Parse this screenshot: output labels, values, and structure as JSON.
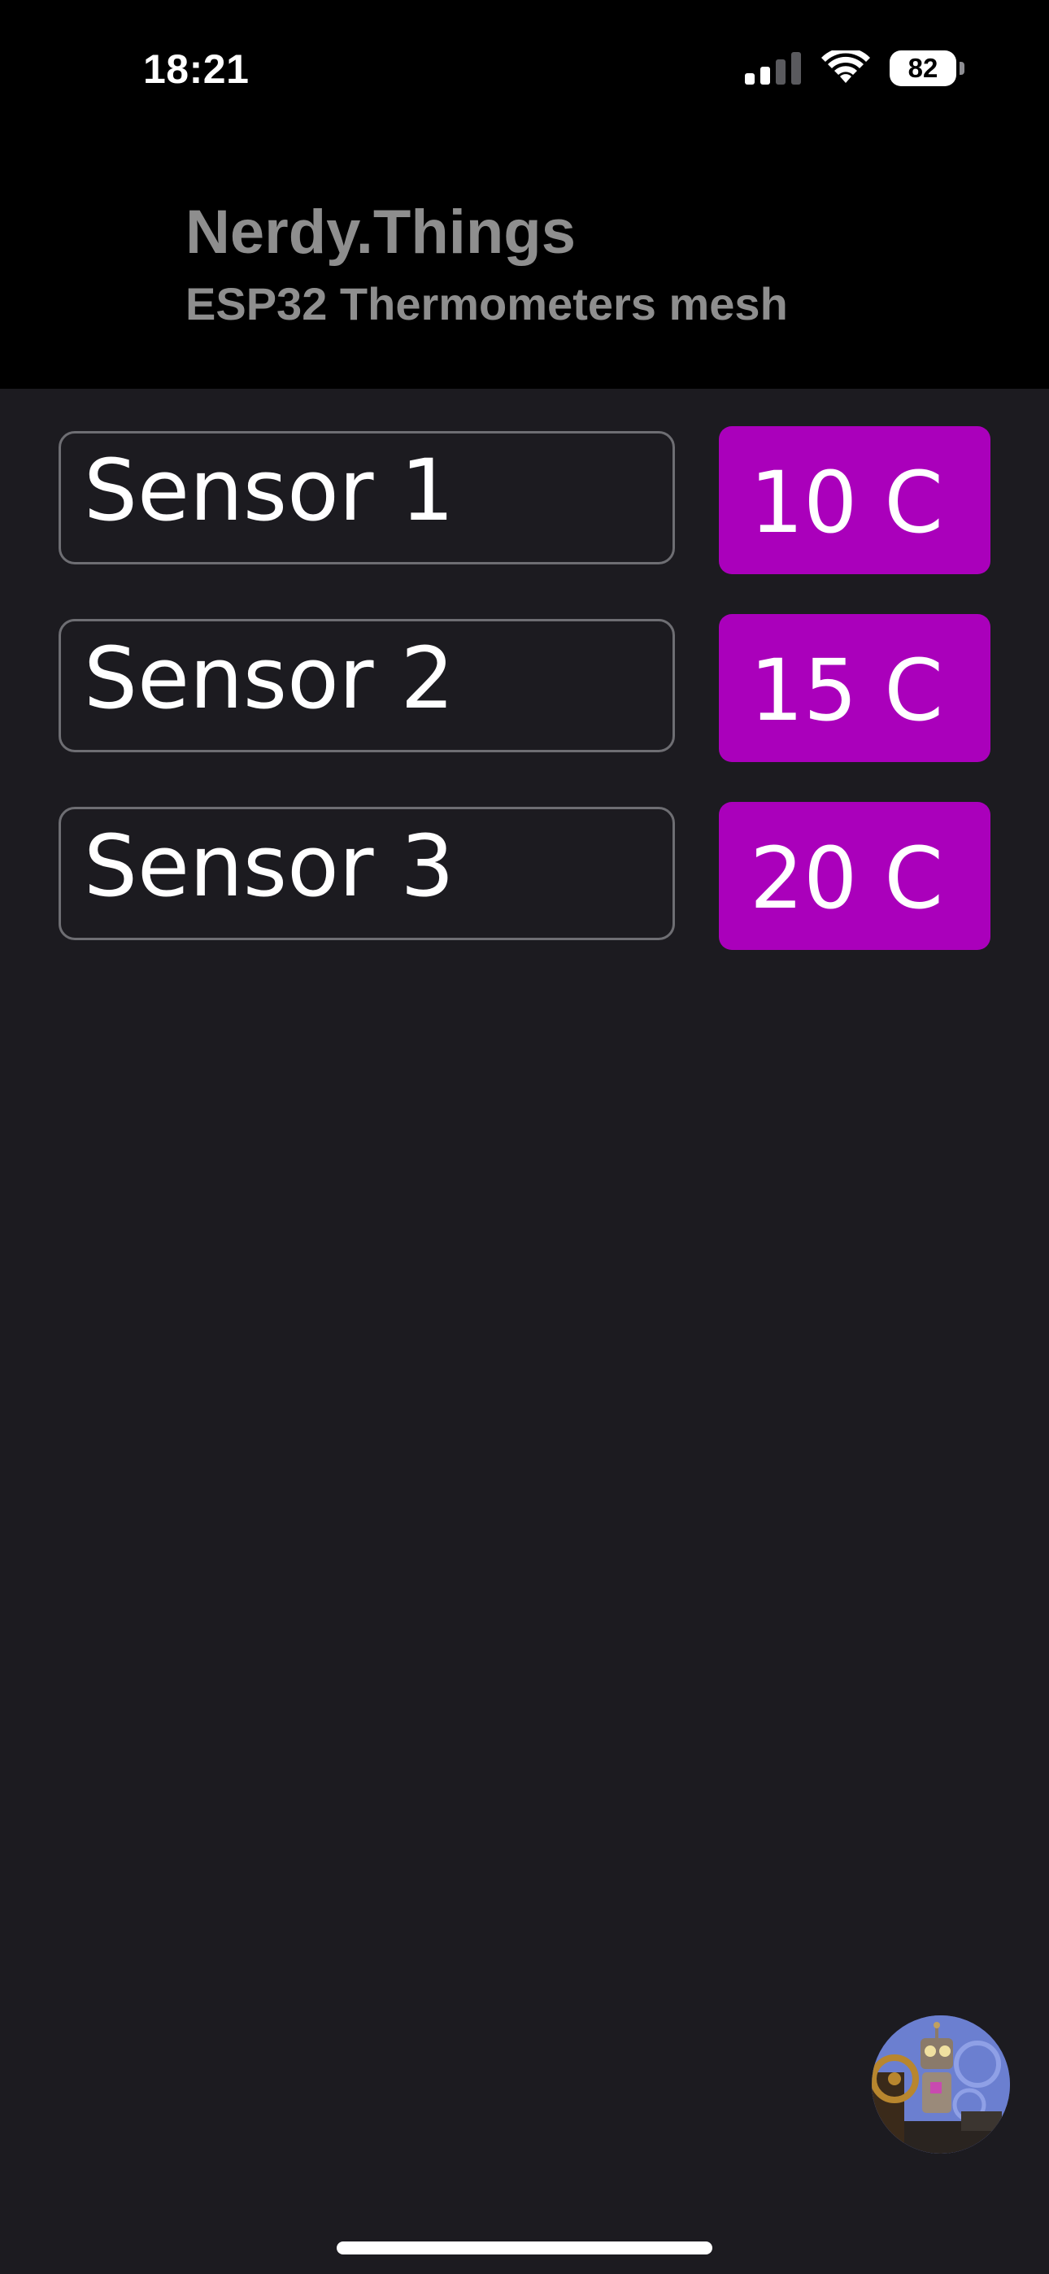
{
  "status_bar": {
    "time": "18:21",
    "battery": "82"
  },
  "header": {
    "title": "Nerdy.Things",
    "subtitle": "ESP32 Thermometers mesh"
  },
  "sensors": [
    {
      "name": "Sensor 1",
      "temperature": "10 C"
    },
    {
      "name": "Sensor 2",
      "temperature": "15 C"
    },
    {
      "name": "Sensor 3",
      "temperature": "20 C"
    }
  ],
  "colors": {
    "temperature_badge": "#aa00bb",
    "background": "#1c1b20",
    "header_background": "#000000",
    "header_text": "#8e8e8e"
  },
  "icons": {
    "signal": "cellular-signal-icon",
    "wifi": "wifi-icon",
    "battery": "battery-icon",
    "avatar": "robot-avatar-icon"
  }
}
